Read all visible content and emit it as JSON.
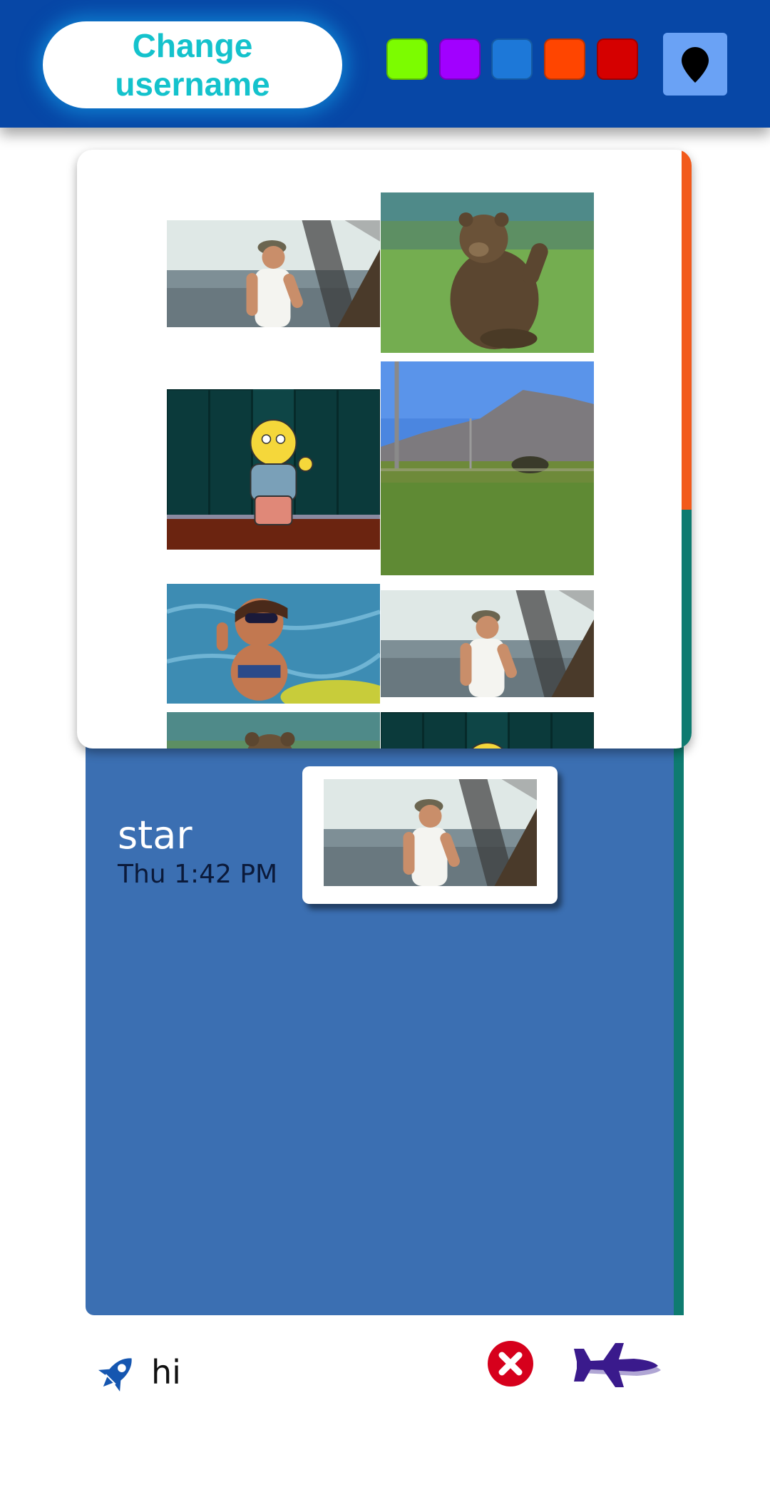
{
  "header": {
    "username_button_label": "Change username",
    "color_swatches": [
      {
        "name": "green",
        "color": "#7cfc00"
      },
      {
        "name": "purple",
        "color": "#a100ff"
      },
      {
        "name": "blue",
        "color": "#1d78d8"
      },
      {
        "name": "orange",
        "color": "#ff4500"
      },
      {
        "name": "red",
        "color": "#d50000"
      }
    ],
    "location_icon": "map-pin-icon"
  },
  "gif_picker": {
    "tiles": [
      {
        "subject": "man in tank top by the sea"
      },
      {
        "subject": "waving bear"
      },
      {
        "subject": "waving cartoon boy by lockers"
      },
      {
        "subject": "grassy field with mountains"
      },
      {
        "subject": "waving woman in sunglasses"
      },
      {
        "subject": "man in tank top by the sea"
      },
      {
        "subject": "waving bear"
      },
      {
        "subject": "waving cartoon boy by lockers"
      }
    ]
  },
  "chat": {
    "messages": [
      {
        "author": "star",
        "time": "Thu 1:42 PM",
        "gif_subject": "man in tank top by the sea"
      }
    ]
  },
  "composer": {
    "value": "hi",
    "left_icon": "rocket-icon",
    "clear_icon": "close-circle-icon",
    "send_icon": "jet-send-icon"
  },
  "colors": {
    "header_bg": "#0747a6",
    "chat_bg": "#3b6fb2",
    "accent_teal": "#0e7b70",
    "accent_orange": "#f25a1b",
    "username_text": "#14c2cc"
  }
}
